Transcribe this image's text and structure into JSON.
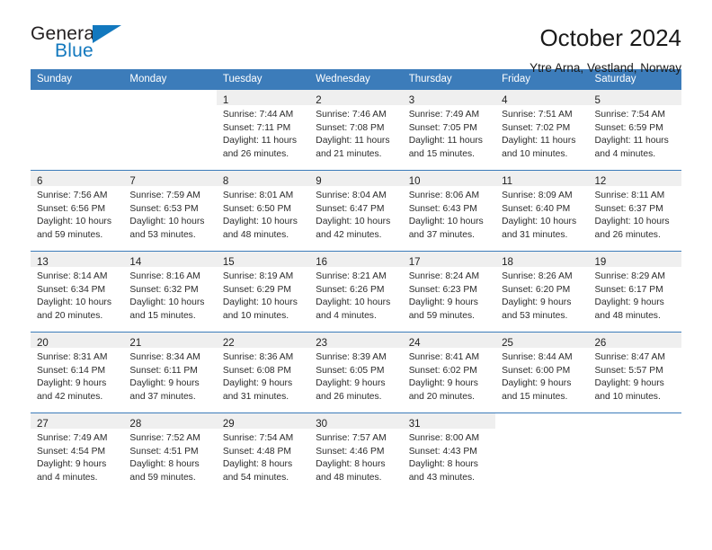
{
  "brand": {
    "name_part1": "General",
    "name_part2": "Blue",
    "triangle_color": "#1278be"
  },
  "header": {
    "title": "October 2024",
    "subtitle": "Ytre Arna, Vestland, Norway"
  },
  "colors": {
    "header_blue": "#3c7cba",
    "daynum_band": "#efefef",
    "text": "#222222"
  },
  "calendar": {
    "weekdays": [
      "Sunday",
      "Monday",
      "Tuesday",
      "Wednesday",
      "Thursday",
      "Friday",
      "Saturday"
    ],
    "weeks": [
      [
        {
          "day": "",
          "lines": []
        },
        {
          "day": "",
          "lines": []
        },
        {
          "day": "1",
          "lines": [
            "Sunrise: 7:44 AM",
            "Sunset: 7:11 PM",
            "Daylight: 11 hours",
            "and 26 minutes."
          ]
        },
        {
          "day": "2",
          "lines": [
            "Sunrise: 7:46 AM",
            "Sunset: 7:08 PM",
            "Daylight: 11 hours",
            "and 21 minutes."
          ]
        },
        {
          "day": "3",
          "lines": [
            "Sunrise: 7:49 AM",
            "Sunset: 7:05 PM",
            "Daylight: 11 hours",
            "and 15 minutes."
          ]
        },
        {
          "day": "4",
          "lines": [
            "Sunrise: 7:51 AM",
            "Sunset: 7:02 PM",
            "Daylight: 11 hours",
            "and 10 minutes."
          ]
        },
        {
          "day": "5",
          "lines": [
            "Sunrise: 7:54 AM",
            "Sunset: 6:59 PM",
            "Daylight: 11 hours",
            "and 4 minutes."
          ]
        }
      ],
      [
        {
          "day": "6",
          "lines": [
            "Sunrise: 7:56 AM",
            "Sunset: 6:56 PM",
            "Daylight: 10 hours",
            "and 59 minutes."
          ]
        },
        {
          "day": "7",
          "lines": [
            "Sunrise: 7:59 AM",
            "Sunset: 6:53 PM",
            "Daylight: 10 hours",
            "and 53 minutes."
          ]
        },
        {
          "day": "8",
          "lines": [
            "Sunrise: 8:01 AM",
            "Sunset: 6:50 PM",
            "Daylight: 10 hours",
            "and 48 minutes."
          ]
        },
        {
          "day": "9",
          "lines": [
            "Sunrise: 8:04 AM",
            "Sunset: 6:47 PM",
            "Daylight: 10 hours",
            "and 42 minutes."
          ]
        },
        {
          "day": "10",
          "lines": [
            "Sunrise: 8:06 AM",
            "Sunset: 6:43 PM",
            "Daylight: 10 hours",
            "and 37 minutes."
          ]
        },
        {
          "day": "11",
          "lines": [
            "Sunrise: 8:09 AM",
            "Sunset: 6:40 PM",
            "Daylight: 10 hours",
            "and 31 minutes."
          ]
        },
        {
          "day": "12",
          "lines": [
            "Sunrise: 8:11 AM",
            "Sunset: 6:37 PM",
            "Daylight: 10 hours",
            "and 26 minutes."
          ]
        }
      ],
      [
        {
          "day": "13",
          "lines": [
            "Sunrise: 8:14 AM",
            "Sunset: 6:34 PM",
            "Daylight: 10 hours",
            "and 20 minutes."
          ]
        },
        {
          "day": "14",
          "lines": [
            "Sunrise: 8:16 AM",
            "Sunset: 6:32 PM",
            "Daylight: 10 hours",
            "and 15 minutes."
          ]
        },
        {
          "day": "15",
          "lines": [
            "Sunrise: 8:19 AM",
            "Sunset: 6:29 PM",
            "Daylight: 10 hours",
            "and 10 minutes."
          ]
        },
        {
          "day": "16",
          "lines": [
            "Sunrise: 8:21 AM",
            "Sunset: 6:26 PM",
            "Daylight: 10 hours",
            "and 4 minutes."
          ]
        },
        {
          "day": "17",
          "lines": [
            "Sunrise: 8:24 AM",
            "Sunset: 6:23 PM",
            "Daylight: 9 hours",
            "and 59 minutes."
          ]
        },
        {
          "day": "18",
          "lines": [
            "Sunrise: 8:26 AM",
            "Sunset: 6:20 PM",
            "Daylight: 9 hours",
            "and 53 minutes."
          ]
        },
        {
          "day": "19",
          "lines": [
            "Sunrise: 8:29 AM",
            "Sunset: 6:17 PM",
            "Daylight: 9 hours",
            "and 48 minutes."
          ]
        }
      ],
      [
        {
          "day": "20",
          "lines": [
            "Sunrise: 8:31 AM",
            "Sunset: 6:14 PM",
            "Daylight: 9 hours",
            "and 42 minutes."
          ]
        },
        {
          "day": "21",
          "lines": [
            "Sunrise: 8:34 AM",
            "Sunset: 6:11 PM",
            "Daylight: 9 hours",
            "and 37 minutes."
          ]
        },
        {
          "day": "22",
          "lines": [
            "Sunrise: 8:36 AM",
            "Sunset: 6:08 PM",
            "Daylight: 9 hours",
            "and 31 minutes."
          ]
        },
        {
          "day": "23",
          "lines": [
            "Sunrise: 8:39 AM",
            "Sunset: 6:05 PM",
            "Daylight: 9 hours",
            "and 26 minutes."
          ]
        },
        {
          "day": "24",
          "lines": [
            "Sunrise: 8:41 AM",
            "Sunset: 6:02 PM",
            "Daylight: 9 hours",
            "and 20 minutes."
          ]
        },
        {
          "day": "25",
          "lines": [
            "Sunrise: 8:44 AM",
            "Sunset: 6:00 PM",
            "Daylight: 9 hours",
            "and 15 minutes."
          ]
        },
        {
          "day": "26",
          "lines": [
            "Sunrise: 8:47 AM",
            "Sunset: 5:57 PM",
            "Daylight: 9 hours",
            "and 10 minutes."
          ]
        }
      ],
      [
        {
          "day": "27",
          "lines": [
            "Sunrise: 7:49 AM",
            "Sunset: 4:54 PM",
            "Daylight: 9 hours",
            "and 4 minutes."
          ]
        },
        {
          "day": "28",
          "lines": [
            "Sunrise: 7:52 AM",
            "Sunset: 4:51 PM",
            "Daylight: 8 hours",
            "and 59 minutes."
          ]
        },
        {
          "day": "29",
          "lines": [
            "Sunrise: 7:54 AM",
            "Sunset: 4:48 PM",
            "Daylight: 8 hours",
            "and 54 minutes."
          ]
        },
        {
          "day": "30",
          "lines": [
            "Sunrise: 7:57 AM",
            "Sunset: 4:46 PM",
            "Daylight: 8 hours",
            "and 48 minutes."
          ]
        },
        {
          "day": "31",
          "lines": [
            "Sunrise: 8:00 AM",
            "Sunset: 4:43 PM",
            "Daylight: 8 hours",
            "and 43 minutes."
          ]
        },
        {
          "day": "",
          "lines": []
        },
        {
          "day": "",
          "lines": []
        }
      ]
    ]
  }
}
